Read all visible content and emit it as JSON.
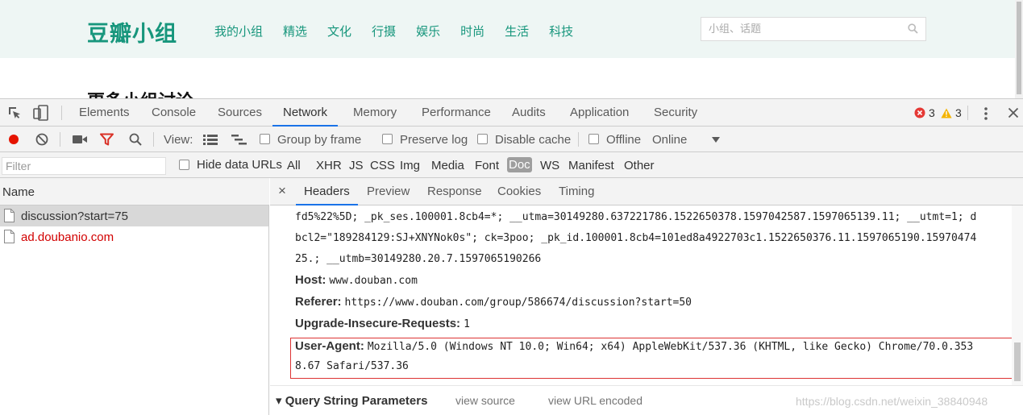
{
  "site": {
    "logo": "豆瓣小组",
    "nav": [
      "我的小组",
      "精选",
      "文化",
      "行摄",
      "娱乐",
      "时尚",
      "生活",
      "科技"
    ],
    "search_placeholder": "小组、话题",
    "heading": "更多小组讨论"
  },
  "devtools": {
    "tabs": [
      "Elements",
      "Console",
      "Sources",
      "Network",
      "Memory",
      "Performance",
      "Audits",
      "Application",
      "Security"
    ],
    "active_tab": "Network",
    "error_count": "3",
    "warning_count": "3",
    "toolbar": {
      "view_label": "View:",
      "group_by_frame": "Group by frame",
      "preserve_log": "Preserve log",
      "disable_cache": "Disable cache",
      "offline": "Offline",
      "throttle": "Online"
    },
    "filter": {
      "placeholder": "Filter",
      "hide_data_urls": "Hide data URLs",
      "types": [
        "All",
        "XHR",
        "JS",
        "CSS",
        "Img",
        "Media",
        "Font",
        "Doc",
        "WS",
        "Manifest",
        "Other"
      ],
      "active_type": "Doc"
    },
    "requests": {
      "column": "Name",
      "items": [
        {
          "name": "discussion?start=75",
          "error": false,
          "selected": true
        },
        {
          "name": "ad.doubanio.com",
          "error": true,
          "selected": false
        }
      ]
    },
    "detail": {
      "close": "×",
      "tabs": [
        "Headers",
        "Preview",
        "Response",
        "Cookies",
        "Timing"
      ],
      "active_tab": "Headers",
      "cookie_lines": [
        "fd5%22%5D; _pk_ses.100001.8cb4=*; __utma=30149280.637221786.1522650378.1597042587.1597065139.11; __utmt=1; d",
        "bcl2=\"189284129:SJ+XNYNok0s\"; ck=3poo; _pk_id.100001.8cb4=101ed8a4922703c1.1522650376.11.1597065190.15970474",
        "25.; __utmb=30149280.20.7.1597065190266"
      ],
      "headers": [
        {
          "key": "Host:",
          "value": "www.douban.com"
        },
        {
          "key": "Referer:",
          "value": "https://www.douban.com/group/586674/discussion?start=50"
        },
        {
          "key": "Upgrade-Insecure-Requests:",
          "value": "1"
        }
      ],
      "user_agent": {
        "key": "User-Agent:",
        "line1": "Mozilla/5.0 (Windows NT 10.0; Win64; x64) AppleWebKit/537.36 (KHTML, like Gecko) Chrome/70.0.353",
        "line2": "8.67 Safari/537.36"
      },
      "query_string": {
        "title": "Query String Parameters",
        "view_source": "view source",
        "view_url_encoded": "view URL encoded"
      },
      "watermark": "https://blog.csdn.net/weixin_38840948"
    }
  }
}
